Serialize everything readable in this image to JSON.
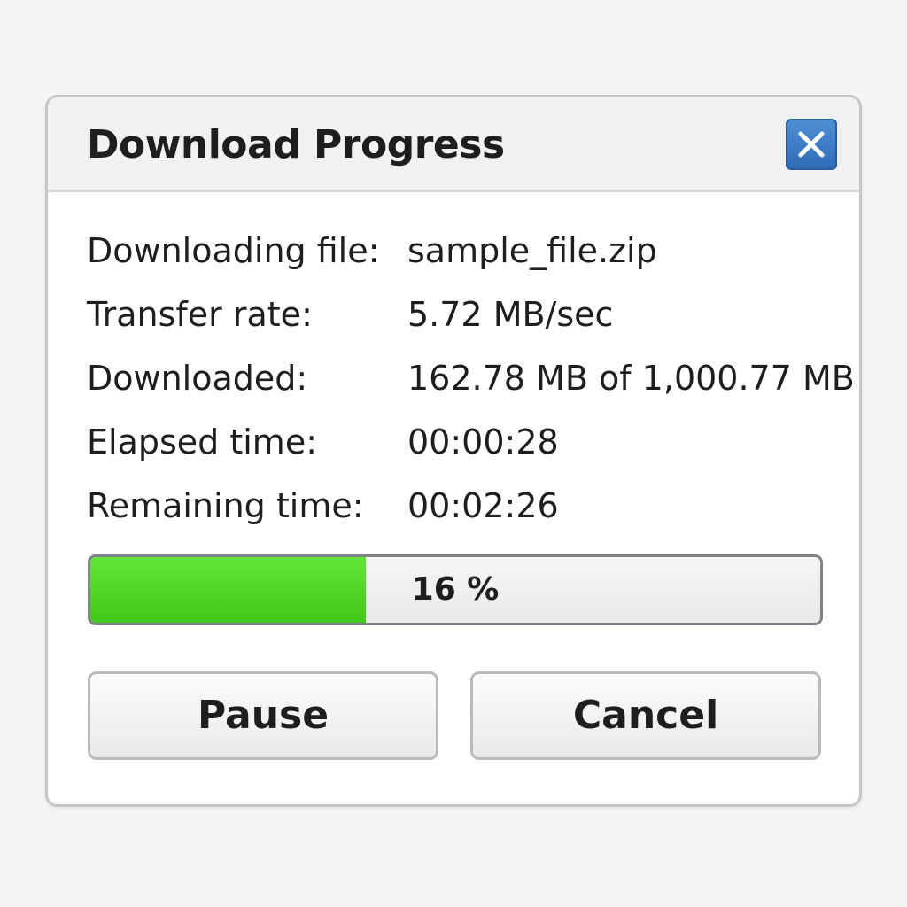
{
  "dialog": {
    "title": "Download Progress",
    "close_icon": "close-icon"
  },
  "details": [
    {
      "label": "Downloading file:",
      "value": "sample_file.zip"
    },
    {
      "label": "Transfer rate:",
      "value": "5.72 MB/sec"
    },
    {
      "label": "Downloaded:",
      "value": "162.78 MB of 1,000.77 MB"
    },
    {
      "label": "Elapsed time:",
      "value": "00:00:28"
    },
    {
      "label": "Remaining time:",
      "value": "00:02:26"
    }
  ],
  "progress": {
    "percent": 16,
    "text": "16 %",
    "fill_color": "#4ed42a"
  },
  "buttons": {
    "pause_label": "Pause",
    "cancel_label": "Cancel"
  },
  "colors": {
    "close_button": "#3a78c3"
  }
}
